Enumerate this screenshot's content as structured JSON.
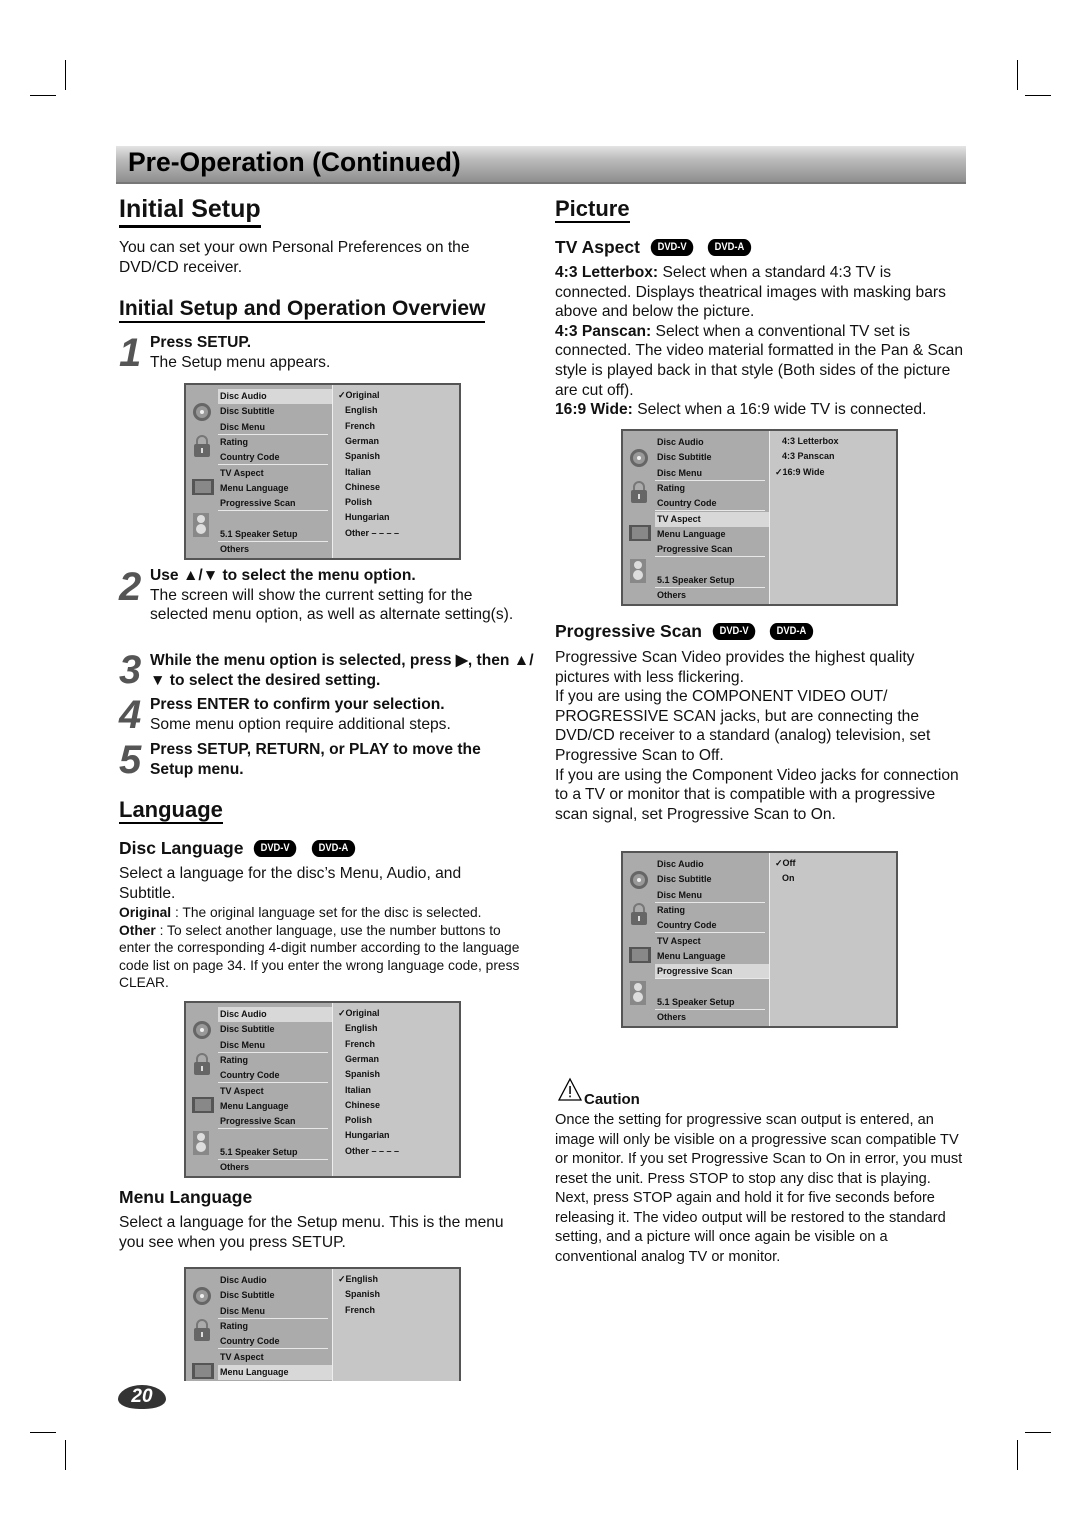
{
  "header": {
    "title": "Pre-Operation (Continued)"
  },
  "left": {
    "title": "Initial Setup",
    "intro": "You can set your own Personal Preferences on the DVD/CD receiver.",
    "overview_title": "Initial Setup and Operation Overview",
    "steps": [
      {
        "num": "1",
        "bold": "Press SETUP.",
        "text": "The Setup menu appears."
      },
      {
        "num": "2",
        "bold": "Use ▲/▼ to select the menu option.",
        "text": "The screen will show the current setting for the selected menu option, as well as alternate setting(s)."
      },
      {
        "num": "3",
        "bold": "While the menu option is selected, press ▶, then ▲/▼ to select the desired setting.",
        "text": ""
      },
      {
        "num": "4",
        "bold": "Press ENTER to confirm your selection.",
        "text": "Some menu option require additional steps."
      },
      {
        "num": "5",
        "bold": "Press SETUP, RETURN, or PLAY to move the Setup menu.",
        "text": ""
      }
    ],
    "language_title": "Language",
    "disc_language": {
      "title": "Disc Language",
      "badges": [
        "DVD-V",
        "DVD-A"
      ],
      "text": "Select a language for the disc’s Menu, Audio, and Subtitle.",
      "original_label": "Original",
      "original_text": " : The original language set for the disc is selected.",
      "other_label": "Other",
      "other_text": " : To select another language, use the number buttons to enter the corresponding 4-digit number according to the language code list on page 34. If you enter the wrong language code, press CLEAR."
    },
    "menu_language": {
      "title": "Menu Language",
      "text": "Select a language for the Setup menu. This is the menu you see when you press SETUP."
    }
  },
  "right": {
    "picture_title": "Picture",
    "tv_aspect": {
      "title": "TV Aspect",
      "badges": [
        "DVD-V",
        "DVD-A"
      ],
      "items": [
        {
          "label": "4:3 Letterbox:",
          "text": " Select when a standard 4:3 TV is connected. Displays theatrical images with masking bars above and below the picture."
        },
        {
          "label": "4:3 Panscan:",
          "text": " Select when a conventional TV set is connected. The video material formatted in the Pan & Scan style is played back in that style (Both sides of the picture are cut off)."
        },
        {
          "label": "16:9 Wide:",
          "text": " Select when a 16:9 wide TV is connected."
        }
      ]
    },
    "progressive": {
      "title": "Progressive Scan",
      "badges": [
        "DVD-V",
        "DVD-A"
      ],
      "paras": [
        "Progressive Scan Video provides the highest quality pictures with less flickering.",
        "If you are using the COMPONENT VIDEO OUT/ PROGRESSIVE SCAN jacks, but are connecting the DVD/CD receiver to a standard (analog) television, set Progressive Scan to Off.",
        "If you are using the Component Video jacks for connection to a TV or monitor that is compatible with a progressive scan signal, set Progressive Scan to On."
      ]
    },
    "caution": {
      "title": "Caution",
      "text": "Once the setting for progressive scan output is entered, an image will only be visible on a progressive scan compatible TV or monitor. If you set Progressive Scan to On in error, you must reset the unit. Press STOP to stop any disc that is playing. Next, press STOP again and hold it for five seconds before releasing it. The video output will be restored to the standard setting, and a picture will once again be visible on a conventional analog TV or monitor."
    }
  },
  "menu_items": [
    "Disc Audio",
    "Disc Subtitle",
    "Disc Menu",
    "Rating",
    "Country Code",
    "TV Aspect",
    "Menu Language",
    "Progressive Scan",
    "",
    "5.1 Speaker Setup",
    "Others"
  ],
  "menus": [
    {
      "highlight": 0,
      "options": [
        "✓Original",
        "English",
        "French",
        "German",
        "Spanish",
        "Italian",
        "Chinese",
        "Polish",
        "Hungarian",
        "Other  – – – –"
      ]
    },
    {
      "highlight": 0,
      "options": [
        "✓Original",
        "English",
        "French",
        "German",
        "Spanish",
        "Italian",
        "Chinese",
        "Polish",
        "Hungarian",
        "Other  – – – –"
      ]
    },
    {
      "highlight": 6,
      "options": [
        "✓English",
        "Spanish",
        "French"
      ]
    },
    {
      "highlight": 5,
      "options": [
        "4:3   Letterbox",
        "4:3   Panscan",
        "✓16:9 Wide"
      ]
    },
    {
      "highlight": 7,
      "options": [
        "✓Off",
        "On"
      ]
    }
  ],
  "page_number": "20",
  "colors": {
    "menu_left": "#ababab",
    "menu_right": "#c6c6c6",
    "badge": "#000000"
  }
}
